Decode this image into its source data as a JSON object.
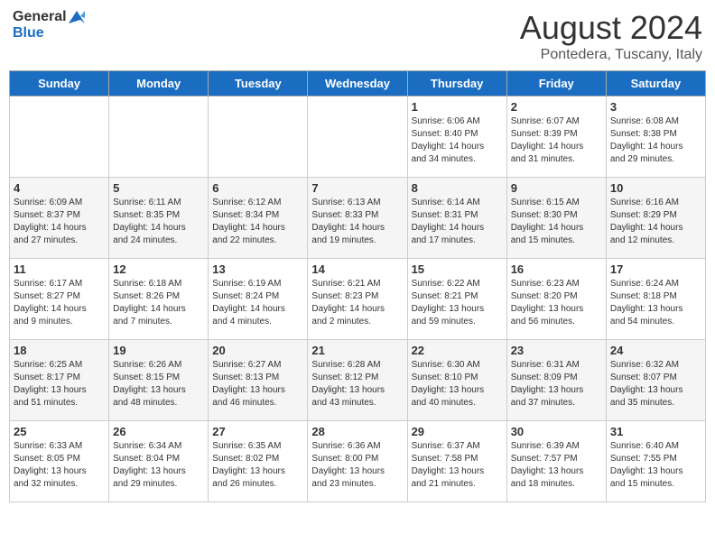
{
  "header": {
    "logo_general": "General",
    "logo_blue": "Blue",
    "title": "August 2024",
    "subtitle": "Pontedera, Tuscany, Italy"
  },
  "weekdays": [
    "Sunday",
    "Monday",
    "Tuesday",
    "Wednesday",
    "Thursday",
    "Friday",
    "Saturday"
  ],
  "weeks": [
    [
      {
        "day": "",
        "info": ""
      },
      {
        "day": "",
        "info": ""
      },
      {
        "day": "",
        "info": ""
      },
      {
        "day": "",
        "info": ""
      },
      {
        "day": "1",
        "info": "Sunrise: 6:06 AM\nSunset: 8:40 PM\nDaylight: 14 hours\nand 34 minutes."
      },
      {
        "day": "2",
        "info": "Sunrise: 6:07 AM\nSunset: 8:39 PM\nDaylight: 14 hours\nand 31 minutes."
      },
      {
        "day": "3",
        "info": "Sunrise: 6:08 AM\nSunset: 8:38 PM\nDaylight: 14 hours\nand 29 minutes."
      }
    ],
    [
      {
        "day": "4",
        "info": "Sunrise: 6:09 AM\nSunset: 8:37 PM\nDaylight: 14 hours\nand 27 minutes."
      },
      {
        "day": "5",
        "info": "Sunrise: 6:11 AM\nSunset: 8:35 PM\nDaylight: 14 hours\nand 24 minutes."
      },
      {
        "day": "6",
        "info": "Sunrise: 6:12 AM\nSunset: 8:34 PM\nDaylight: 14 hours\nand 22 minutes."
      },
      {
        "day": "7",
        "info": "Sunrise: 6:13 AM\nSunset: 8:33 PM\nDaylight: 14 hours\nand 19 minutes."
      },
      {
        "day": "8",
        "info": "Sunrise: 6:14 AM\nSunset: 8:31 PM\nDaylight: 14 hours\nand 17 minutes."
      },
      {
        "day": "9",
        "info": "Sunrise: 6:15 AM\nSunset: 8:30 PM\nDaylight: 14 hours\nand 15 minutes."
      },
      {
        "day": "10",
        "info": "Sunrise: 6:16 AM\nSunset: 8:29 PM\nDaylight: 14 hours\nand 12 minutes."
      }
    ],
    [
      {
        "day": "11",
        "info": "Sunrise: 6:17 AM\nSunset: 8:27 PM\nDaylight: 14 hours\nand 9 minutes."
      },
      {
        "day": "12",
        "info": "Sunrise: 6:18 AM\nSunset: 8:26 PM\nDaylight: 14 hours\nand 7 minutes."
      },
      {
        "day": "13",
        "info": "Sunrise: 6:19 AM\nSunset: 8:24 PM\nDaylight: 14 hours\nand 4 minutes."
      },
      {
        "day": "14",
        "info": "Sunrise: 6:21 AM\nSunset: 8:23 PM\nDaylight: 14 hours\nand 2 minutes."
      },
      {
        "day": "15",
        "info": "Sunrise: 6:22 AM\nSunset: 8:21 PM\nDaylight: 13 hours\nand 59 minutes."
      },
      {
        "day": "16",
        "info": "Sunrise: 6:23 AM\nSunset: 8:20 PM\nDaylight: 13 hours\nand 56 minutes."
      },
      {
        "day": "17",
        "info": "Sunrise: 6:24 AM\nSunset: 8:18 PM\nDaylight: 13 hours\nand 54 minutes."
      }
    ],
    [
      {
        "day": "18",
        "info": "Sunrise: 6:25 AM\nSunset: 8:17 PM\nDaylight: 13 hours\nand 51 minutes."
      },
      {
        "day": "19",
        "info": "Sunrise: 6:26 AM\nSunset: 8:15 PM\nDaylight: 13 hours\nand 48 minutes."
      },
      {
        "day": "20",
        "info": "Sunrise: 6:27 AM\nSunset: 8:13 PM\nDaylight: 13 hours\nand 46 minutes."
      },
      {
        "day": "21",
        "info": "Sunrise: 6:28 AM\nSunset: 8:12 PM\nDaylight: 13 hours\nand 43 minutes."
      },
      {
        "day": "22",
        "info": "Sunrise: 6:30 AM\nSunset: 8:10 PM\nDaylight: 13 hours\nand 40 minutes."
      },
      {
        "day": "23",
        "info": "Sunrise: 6:31 AM\nSunset: 8:09 PM\nDaylight: 13 hours\nand 37 minutes."
      },
      {
        "day": "24",
        "info": "Sunrise: 6:32 AM\nSunset: 8:07 PM\nDaylight: 13 hours\nand 35 minutes."
      }
    ],
    [
      {
        "day": "25",
        "info": "Sunrise: 6:33 AM\nSunset: 8:05 PM\nDaylight: 13 hours\nand 32 minutes."
      },
      {
        "day": "26",
        "info": "Sunrise: 6:34 AM\nSunset: 8:04 PM\nDaylight: 13 hours\nand 29 minutes."
      },
      {
        "day": "27",
        "info": "Sunrise: 6:35 AM\nSunset: 8:02 PM\nDaylight: 13 hours\nand 26 minutes."
      },
      {
        "day": "28",
        "info": "Sunrise: 6:36 AM\nSunset: 8:00 PM\nDaylight: 13 hours\nand 23 minutes."
      },
      {
        "day": "29",
        "info": "Sunrise: 6:37 AM\nSunset: 7:58 PM\nDaylight: 13 hours\nand 21 minutes."
      },
      {
        "day": "30",
        "info": "Sunrise: 6:39 AM\nSunset: 7:57 PM\nDaylight: 13 hours\nand 18 minutes."
      },
      {
        "day": "31",
        "info": "Sunrise: 6:40 AM\nSunset: 7:55 PM\nDaylight: 13 hours\nand 15 minutes."
      }
    ]
  ]
}
